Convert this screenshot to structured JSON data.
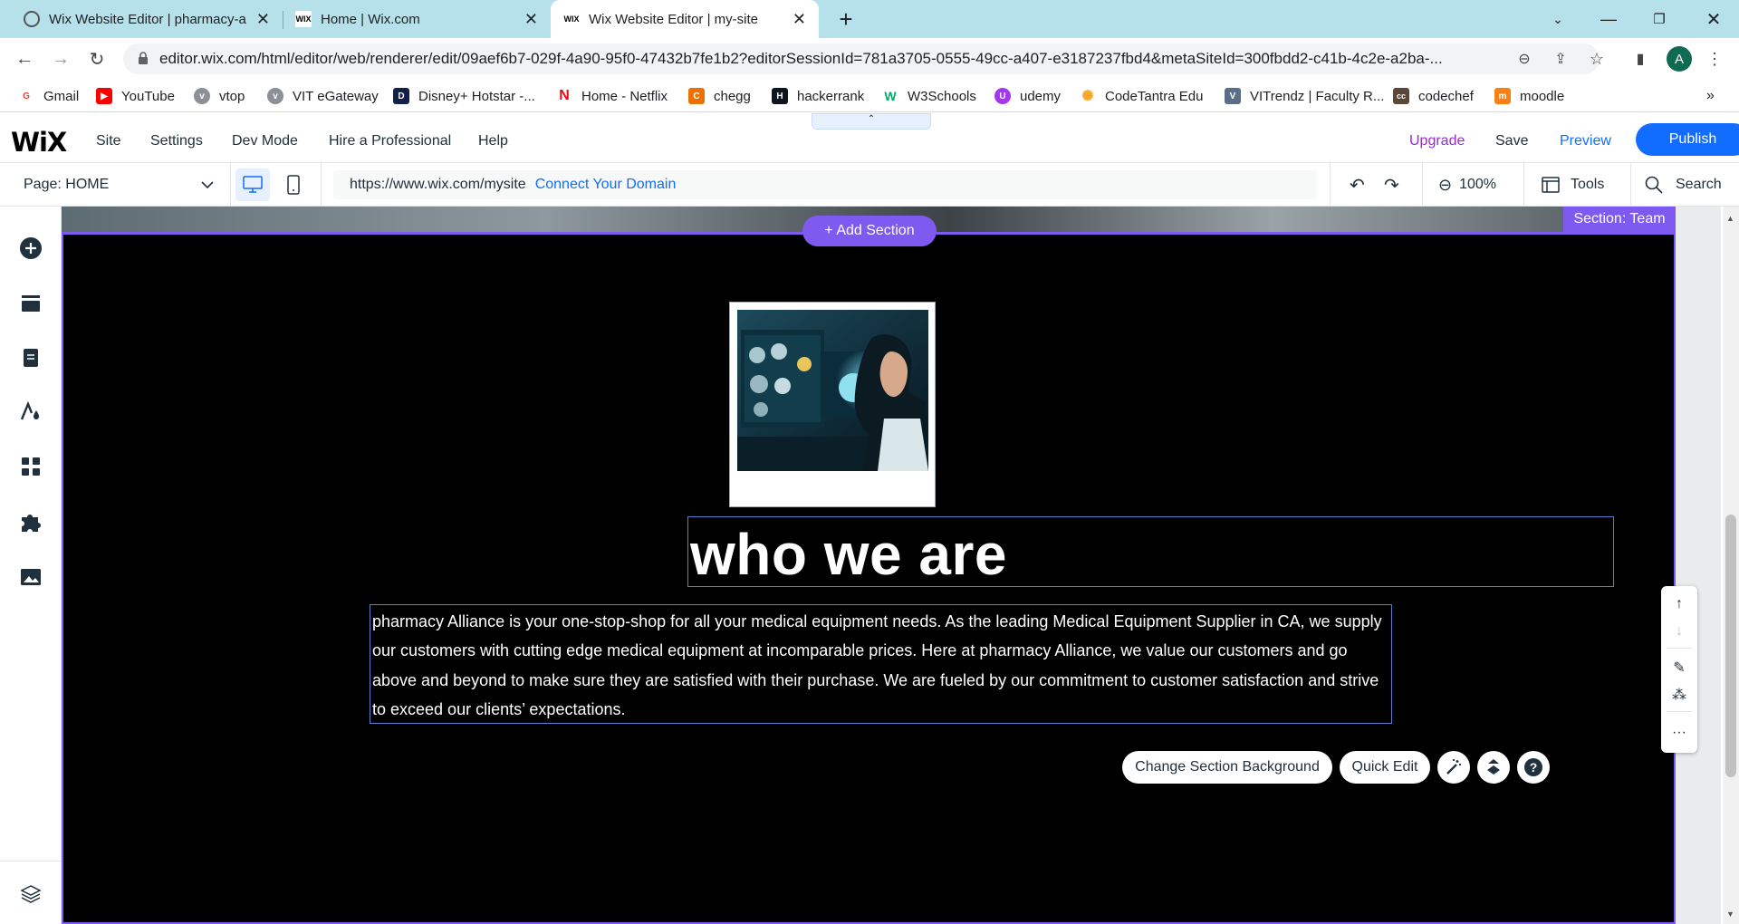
{
  "browser": {
    "tabs": [
      {
        "title": "Wix Website Editor | pharmacy-a",
        "favicon": "globe-icon"
      },
      {
        "title": "Home | Wix.com",
        "favicon": "WIX"
      },
      {
        "title": "Wix Website Editor | my-site",
        "favicon": "WIX",
        "active": true
      }
    ],
    "url": "editor.wix.com/html/editor/web/renderer/edit/09aef6b7-029f-4a90-95f0-47432b7fe1b2?editorSessionId=781a3705-0555-49cc-a407-e3187237fbd4&metaSiteId=300fbdd2-c41b-4c2e-a2ba-...",
    "profile_initial": "A",
    "bookmarks": [
      {
        "label": "Gmail",
        "icon": "G",
        "color": "#ea4335"
      },
      {
        "label": "YouTube",
        "icon": "▶",
        "color": "#ff0000"
      },
      {
        "label": "vtop",
        "icon": "v",
        "color": "#8a8f98"
      },
      {
        "label": "VIT eGateway",
        "icon": "v",
        "color": "#8a8f98"
      },
      {
        "label": "Disney+ Hotstar -...",
        "icon": "D",
        "color": "#13204c"
      },
      {
        "label": "Home - Netflix",
        "icon": "N",
        "color": "#e50914"
      },
      {
        "label": "chegg",
        "icon": "C",
        "color": "#eb7100"
      },
      {
        "label": "hackerrank",
        "icon": "H",
        "color": "#0e141e"
      },
      {
        "label": "W3Schools",
        "icon": "W",
        "color": "#04aa6d"
      },
      {
        "label": "udemy",
        "icon": "U",
        "color": "#a435f0"
      },
      {
        "label": "CodeTantra Edu",
        "icon": "✺",
        "color": "#f5a623"
      },
      {
        "label": "VITrendz | Faculty R...",
        "icon": "V",
        "color": "#5a6e8c"
      },
      {
        "label": "codechef",
        "icon": "cc",
        "color": "#5b4638"
      },
      {
        "label": "moodle",
        "icon": "m",
        "color": "#f98012"
      }
    ]
  },
  "wix": {
    "logo": "WiX",
    "menu": [
      "Site",
      "Settings",
      "Dev Mode",
      "Hire a Professional",
      "Help"
    ],
    "upgrade": "Upgrade",
    "save": "Save",
    "preview": "Preview",
    "publish": "Publish",
    "page_label": "Page: HOME",
    "site_url": "https://www.wix.com/mysite",
    "connect_domain": "Connect Your Domain",
    "zoom": "100%",
    "tools": "Tools",
    "search": "Search"
  },
  "canvas": {
    "section_tag": "Section: Team",
    "add_section": "+ Add Section",
    "heading": "who we are",
    "paragraph": "pharmacy Alliance is your one-stop-shop for all your medical equipment needs. As the leading Medical Equipment Supplier in CA, we supply our customers with cutting edge medical equipment at incomparable prices. Here at pharmacy Alliance, we value our customers and go above and beyond to make sure they are satisfied with their purchase. We are fueled by our commitment to customer satisfaction and strive to exceed our clients’ expectations.",
    "change_bg": "Change Section Background",
    "quick_edit": "Quick Edit"
  },
  "colors": {
    "accent_purple": "#7f5af0",
    "wix_blue": "#116dff",
    "upgrade_purple": "#9a27d5"
  }
}
